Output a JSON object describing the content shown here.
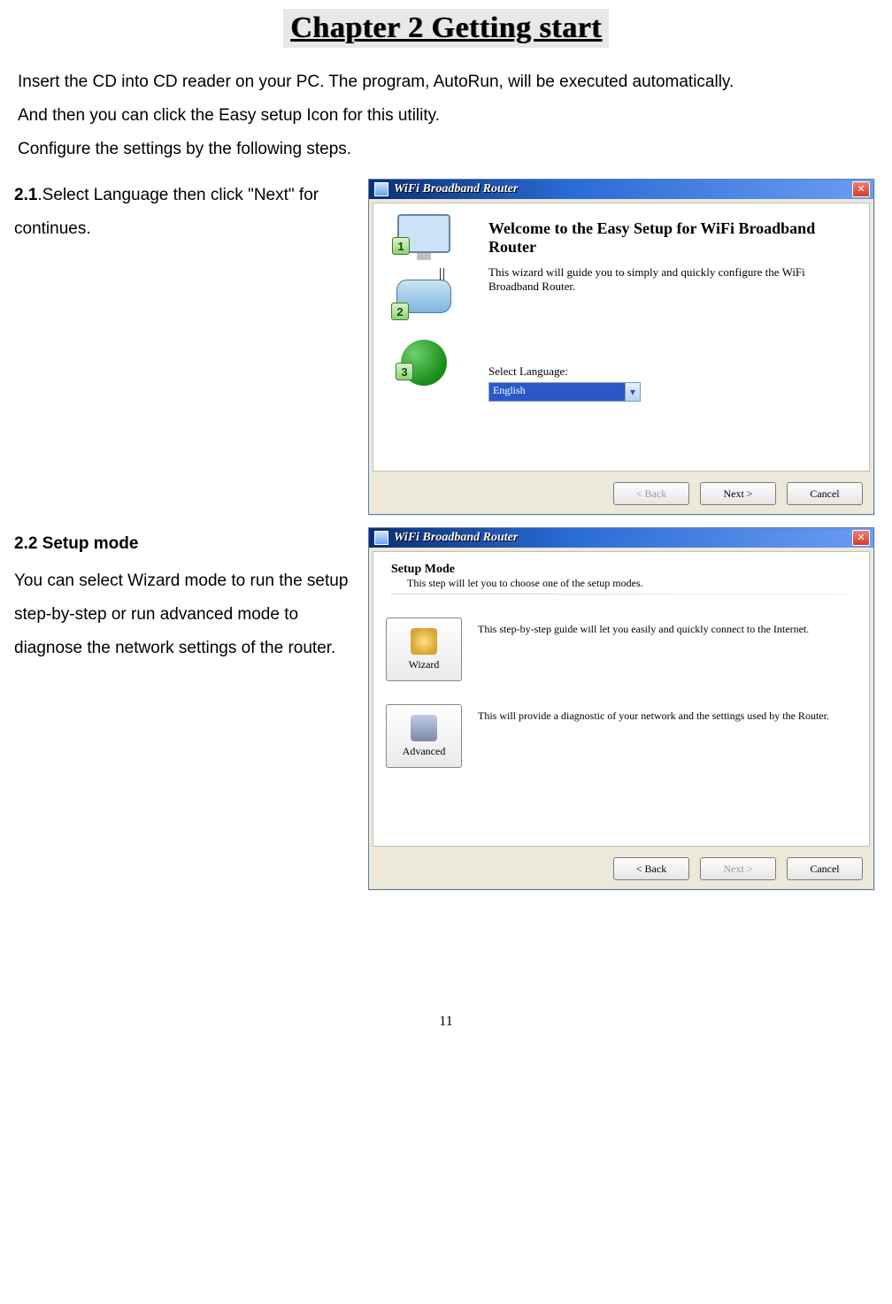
{
  "chapter_title": "Chapter 2 Getting start",
  "intro_lines": [
    "Insert the CD into CD reader on your PC. The program, AutoRun, will be executed automatically.",
    "And then you can click the Easy setup Icon for this utility.",
    "Configure the settings by the following steps."
  ],
  "section21": {
    "head": "2.1",
    "text": ".Select Language then click \"Next\" for continues."
  },
  "section22": {
    "head": "2.2  Setup mode",
    "text": "You can select Wizard mode to run the setup step-by-step or run advanced mode to diagnose the network settings of the router."
  },
  "dialog1": {
    "title": "WiFi Broadband Router",
    "steps": [
      "1",
      "2",
      "3"
    ],
    "welcome_h": "Welcome to the Easy Setup for WiFi Broadband Router",
    "welcome_p": "This wizard will guide you to simply and quickly configure the WiFi Broadband Router.",
    "select_label": "Select Language:",
    "language": "English",
    "btn_back": "< Back",
    "btn_next": "Next >",
    "btn_cancel": "Cancel"
  },
  "dialog2": {
    "title": "WiFi Broadband Router",
    "h2_title": "Setup Mode",
    "h2_sub": "This step will let you to choose one of the setup modes.",
    "wizard_label": "Wizard",
    "wizard_desc": "This step-by-step guide will let you easily and quickly connect to the Internet.",
    "advanced_label": "Advanced",
    "advanced_desc": "This will provide a diagnostic of your network and the settings used by the Router.",
    "btn_back": "< Back",
    "btn_next": "Next >",
    "btn_cancel": "Cancel"
  },
  "page_number": "11"
}
